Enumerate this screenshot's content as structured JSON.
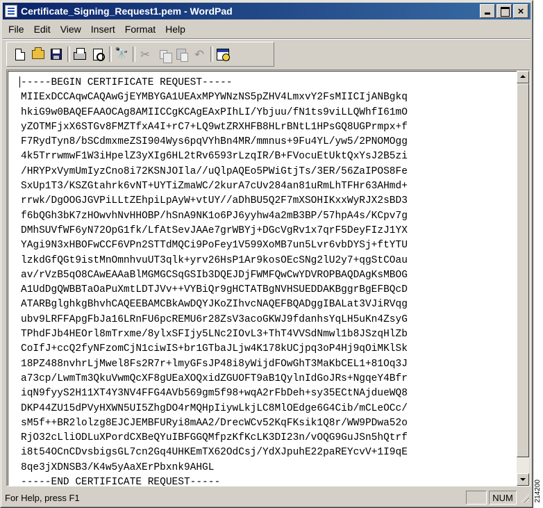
{
  "window": {
    "title": "Certificate_Signing_Request1.pem - WordPad",
    "close_glyph": "×"
  },
  "menu": [
    "File",
    "Edit",
    "View",
    "Insert",
    "Format",
    "Help"
  ],
  "toolbar": {
    "icons": [
      "new-document-icon",
      "open-folder-icon",
      "save-disk-icon",
      "print-icon",
      "print-preview-icon",
      "find-binoculars-icon",
      "cut-scissors-icon",
      "copy-icon",
      "paste-icon",
      "undo-icon",
      "date-time-icon"
    ],
    "find_glyph": "🔭",
    "cut_glyph": "✂",
    "undo_glyph": "↶"
  },
  "document": {
    "lines": [
      "-----BEGIN CERTIFICATE REQUEST-----",
      "MIIExDCCAqwCAQAwGjEYMBYGA1UEAxMPYWNzNS5pZHV4LmxvY2FsMIICIjANBgkq",
      "hkiG9w0BAQEFAAOCAg8AMIICCgKCAgEAxPIhLI/Ybjuu/fN1ts9viLLQWhfI61mO",
      "yZOTMFjxX6STGv8FMZTfxA4I+rC7+LQ9wtZRXHFB8HLrBNtL1HPsGQ8UGPrmpx+f",
      "F7RydTyn8/bSCdmxmeZSI904Wys6pqVYhBn4MR/mmnus+9Fu4YL/yw5/2PNOMOgg",
      "4k5TrrwmwF1W3iHpelZ3yXIg6HL2tRv6593rLzqIR/B+FVocuEtUktQxYsJ2B5zi",
      "/HRYPxVymUmIyzCno8i72KSNJOIla//uQlpAQEo5PWiGtjTs/3ER/56ZaIPOS8Fe",
      "SxUp1T3/KSZGtahrk6vNT+UYTiZmaWC/2kurA7cUv284an81uRmLhTFHr63AHmd+",
      "rrwk/DgOOGJGVPiLLtZEhpiLpAyW+vtUY//aDhBU5Q2F7mXSOHIKxxWyRJX2sBD3",
      "f6bQGh3bK7zHOwvhNvHHOBP/hSnA9NK1o6PJ6yyhw4a2mB3BP/57hpA4s/KCpv7g",
      "DMhSUVfWF6yN72OpG1fk/LfAtSevJAAe7grWBYj+DGcVgRv1x7qrF5DeyFIzJ1YX",
      "YAgi9N3xHBOFwCCF6VPn2STTdMQCi9PoFey1V599XoMB7un5Lvr6vbDYSj+ftYTU",
      "lzkdGfQGt9istMnOmnhvuUT3qlk+yrv26HsP1Ar9kosOEcSNg2lU2y7+qgStCOau",
      "av/rVzB5qO8CAwEAAaBlMGMGCSqGSIb3DQEJDjFWMFQwCwYDVROPBAQDAgKsMBOG",
      "A1UdDgQWBBTaOaPuXmtLDTJVv++VYBiQr9gHCTATBgNVHSUEDDAKBggrBgEFBQcD",
      "ATARBglghkgBhvhCAQEEBAMCBkAwDQYJKoZIhvcNAQEFBQADggIBALat3VJiRVqg",
      "ubv9LRFFApgFbJa16LRnFU6pcREMU6r28ZsV3acoGKWJ9fdanhsYqLH5uKn4ZsyG",
      "TPhdFJb4HEOrl8mTrxme/8ylxSFIjy5LNc2IOvL3+ThT4VVSdNmwl1b8JSzqHlZb",
      "CoIfJ+ccQ2fyNFzomCjN1ciwIS+br1GTbaJLjw4K178kUCjpq3oP4Hj9qOiMKlSk",
      "18PZ488nvhrLjMwel8Fs2R7r+lmyGFsJP48i8yWijdFOwGhT3MaKbCEL1+81Oq3J",
      "a73cp/LwmTm3QkuVwmQcXF8gUEaXOQxidZGUOFT9aB1QylnIdGoJRs+NgqeY4Bfr",
      "iqN9fyyS2H11XT4Y3NV4FFG4AVb569gm5f98+wqA2rFbDeh+sy35ECtNAjdueWQ8",
      "DKP44ZU15dPVyHXWN5UI5ZhgDO4rMQHpIiywLkjLC8MlOEdge6G4Cib/mCLeOCc/",
      "sM5f++BR2lolzg8EJCJEMBFURyi8mAA2/DrecWCv52KqFKsik1Q8r/WW9PDwa52o",
      "RjO32cLliODLuXPordCXBeQYuIBFGGQMfpzKfKcLK3DI23n/vOQG9GuJSn5hQtrf",
      "i8t54OCnCDvsbigsGL7cn2Gq4UHKEmTX62OdCsj/YdXJpuhE22paREYcvV+1I9qE",
      "8qe3jXDNSB3/K4w5yAaXErPbxnk9AHGL",
      "-----END CERTIFICATE REQUEST-----"
    ]
  },
  "status": {
    "help_text": "For Help, press F1",
    "blank_panel": "",
    "num_indicator": "NUM"
  },
  "side_label": "214200"
}
